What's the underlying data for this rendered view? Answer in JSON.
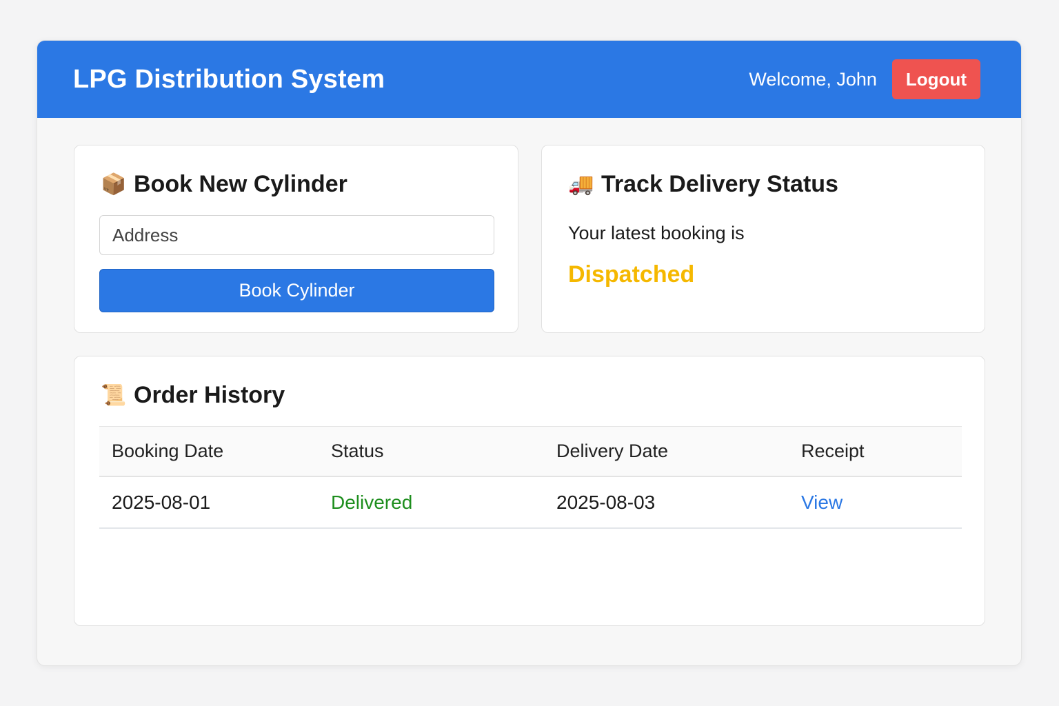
{
  "header": {
    "title": "LPG Distribution System",
    "welcome": "Welcome, John",
    "logout_label": "Logout",
    "color": "#2b78e4"
  },
  "book": {
    "icon": "package-icon",
    "title": "Book New Cylinder",
    "address_placeholder": "Address",
    "address_value": "",
    "button_label": "Book Cylinder"
  },
  "track": {
    "icon": "delivery-truck-icon",
    "title": "Track Delivery Status",
    "text": "Your latest booking is",
    "status": "Dispatched",
    "status_color": "#f5b800"
  },
  "history": {
    "icon": "scroll-icon",
    "title": "Order History",
    "columns": [
      "Booking Date",
      "Status",
      "Delivery Date",
      "Receipt"
    ],
    "rows": [
      {
        "booking_date": "2025-08-01",
        "status": "Delivered",
        "delivery_date": "2025-08-03",
        "receipt": "View"
      }
    ]
  }
}
